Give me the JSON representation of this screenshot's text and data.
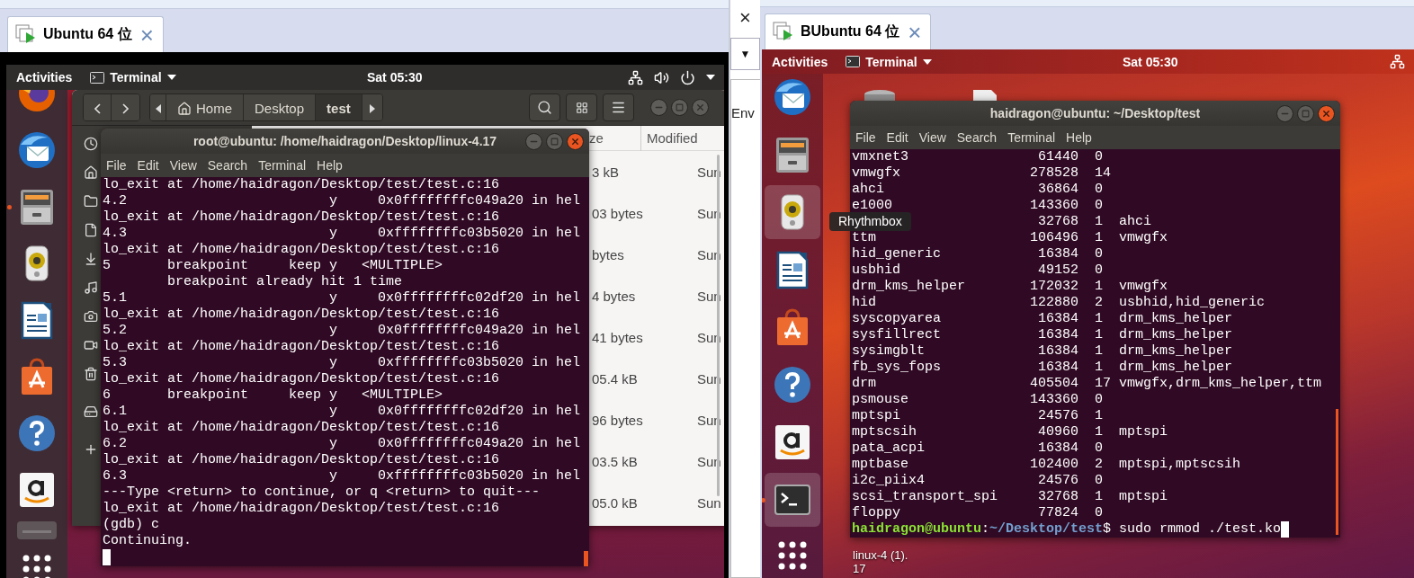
{
  "left_vm": {
    "tab": {
      "title": "Ubuntu 64 位",
      "close": "×"
    },
    "topbar": {
      "activities": "Activities",
      "app": "Terminal",
      "clock": "Sat 05:30"
    },
    "dock": [
      {
        "kind": "firefox",
        "running": false,
        "selected": false
      },
      {
        "kind": "thunderbird",
        "running": false,
        "selected": false
      },
      {
        "kind": "files",
        "running": true,
        "selected": false
      },
      {
        "kind": "rhythmbox",
        "running": false,
        "selected": false
      },
      {
        "kind": "writer",
        "running": false,
        "selected": false
      },
      {
        "kind": "software",
        "running": false,
        "selected": false
      },
      {
        "kind": "help",
        "running": false,
        "selected": false
      },
      {
        "kind": "amazon",
        "running": false,
        "selected": false
      },
      {
        "kind": "partial",
        "running": false,
        "selected": false
      },
      {
        "kind": "apps",
        "running": false,
        "selected": false
      }
    ],
    "file_manager": {
      "path": [
        {
          "label": "Home",
          "kind": "home",
          "selected": false
        },
        {
          "label": "Desktop",
          "kind": "plain",
          "selected": false
        },
        {
          "label": "test",
          "kind": "plain",
          "selected": true
        }
      ],
      "columns": [
        "ze",
        "Modified"
      ],
      "rows": [
        {
          "size": "3 kB",
          "modified": "Sun"
        },
        {
          "size": "03 bytes",
          "modified": "Sun"
        },
        {
          "size": "bytes",
          "modified": "Sun"
        },
        {
          "size": "4 bytes",
          "modified": "Sun"
        },
        {
          "size": "41 bytes",
          "modified": "Sun"
        },
        {
          "size": "05.4 kB",
          "modified": "Sun"
        },
        {
          "size": "96 bytes",
          "modified": "Sun"
        },
        {
          "size": "03.5 kB",
          "modified": "Sun"
        },
        {
          "size": "05.0 kB",
          "modified": "Sun"
        }
      ]
    },
    "terminal": {
      "title": "root@ubuntu: /home/haidragon/Desktop/linux-4.17",
      "menu": [
        "File",
        "Edit",
        "View",
        "Search",
        "Terminal",
        "Help"
      ],
      "lines": [
        "lo_exit at /home/haidragon/Desktop/test/test.c:16",
        "4.2                         y     0x0ffffffffc049a20 in hel",
        "lo_exit at /home/haidragon/Desktop/test/test.c:16",
        "4.3                         y     0xffffffffc03b5020 in hel",
        "lo_exit at /home/haidragon/Desktop/test/test.c:16",
        "5       breakpoint     keep y   <MULTIPLE>",
        "        breakpoint already hit 1 time",
        "5.1                         y     0x0ffffffffc02df20 in hel",
        "lo_exit at /home/haidragon/Desktop/test/test.c:16",
        "5.2                         y     0x0ffffffffc049a20 in hel",
        "lo_exit at /home/haidragon/Desktop/test/test.c:16",
        "5.3                         y     0xffffffffc03b5020 in hel",
        "lo_exit at /home/haidragon/Desktop/test/test.c:16",
        "6       breakpoint     keep y   <MULTIPLE>",
        "6.1                         y     0x0ffffffffc02df20 in hel",
        "lo_exit at /home/haidragon/Desktop/test/test.c:16",
        "6.2                         y     0x0ffffffffc049a20 in hel",
        "lo_exit at /home/haidragon/Desktop/test/test.c:16",
        "6.3                         y     0xffffffffc03b5020 in hel",
        "---Type <return> to continue, or q <return> to quit---",
        "lo_exit at /home/haidragon/Desktop/test/test.c:16",
        "(gdb) c",
        "Continuing."
      ]
    }
  },
  "right_vm": {
    "host_strip": {
      "close": "×",
      "dropdown": "▼",
      "text": "Env"
    },
    "tab": {
      "title": "BUbuntu 64 位",
      "close": "×"
    },
    "topbar": {
      "activities": "Activities",
      "app": "Terminal",
      "clock": "Sat 05:30"
    },
    "dock": [
      {
        "kind": "thunderbird",
        "running": false,
        "selected": false
      },
      {
        "kind": "files",
        "running": false,
        "selected": false
      },
      {
        "kind": "rhythmbox",
        "running": false,
        "selected": true
      },
      {
        "kind": "writer",
        "running": false,
        "selected": false
      },
      {
        "kind": "software",
        "running": false,
        "selected": false
      },
      {
        "kind": "help",
        "running": false,
        "selected": false
      },
      {
        "kind": "amazon",
        "running": false,
        "selected": false
      },
      {
        "kind": "terminal",
        "running": true,
        "selected": true
      },
      {
        "kind": "apps",
        "running": false,
        "selected": false
      }
    ],
    "terminal": {
      "title": "haidragon@ubuntu: ~/Desktop/test",
      "menu": [
        "File",
        "Edit",
        "View",
        "Search",
        "Terminal",
        "Help"
      ],
      "modules": [
        {
          "name": "vmxnet3",
          "size": "61440",
          "used": "0"
        },
        {
          "name": "vmwgfx",
          "size": "278528",
          "used": "14"
        },
        {
          "name": "ahci",
          "size": "36864",
          "used": "0"
        },
        {
          "name": "e1000",
          "size": "143360",
          "used": "0"
        },
        {
          "size": "32768",
          "used": "1",
          "by": "ahci"
        },
        {
          "name": "ttm",
          "size": "106496",
          "used": "1",
          "by": "vmwgfx"
        },
        {
          "name": "hid_generic",
          "size": "16384",
          "used": "0"
        },
        {
          "name": "usbhid",
          "size": "49152",
          "used": "0"
        },
        {
          "name": "drm_kms_helper",
          "size": "172032",
          "used": "1",
          "by": "vmwgfx"
        },
        {
          "name": "hid",
          "size": "122880",
          "used": "2",
          "by": "usbhid,hid_generic"
        },
        {
          "name": "syscopyarea",
          "size": "16384",
          "used": "1",
          "by": "drm_kms_helper"
        },
        {
          "name": "sysfillrect",
          "size": "16384",
          "used": "1",
          "by": "drm_kms_helper"
        },
        {
          "name": "sysimgblt",
          "size": "16384",
          "used": "1",
          "by": "drm_kms_helper"
        },
        {
          "name": "fb_sys_fops",
          "size": "16384",
          "used": "1",
          "by": "drm_kms_helper"
        },
        {
          "name": "drm",
          "size": "405504",
          "used": "17",
          "by": "vmwgfx,drm_kms_helper,ttm"
        },
        {
          "name": "psmouse",
          "size": "143360",
          "used": "0"
        },
        {
          "name": "mptspi",
          "size": "24576",
          "used": "1"
        },
        {
          "name": "mptscsih",
          "size": "40960",
          "used": "1",
          "by": "mptspi"
        },
        {
          "name": "pata_acpi",
          "size": "16384",
          "used": "0"
        },
        {
          "name": "mptbase",
          "size": "102400",
          "used": "2",
          "by": "mptspi,mptscsih"
        },
        {
          "name": "i2c_piix4",
          "size": "24576",
          "used": "0"
        },
        {
          "name": "scsi_transport_spi",
          "size": "32768",
          "used": "1",
          "by": "mptspi"
        },
        {
          "name": "floppy",
          "size": "77824",
          "used": "0"
        }
      ],
      "prompt": {
        "user": "haidragon@ubuntu",
        "sep": ":",
        "path": "~/Desktop/test",
        "command": "$ sudo rmmod ./test.ko"
      }
    },
    "tooltip": "Rhythmbox",
    "desktop_file": {
      "name_lines": [
        "linux-4 (1).",
        "17"
      ]
    }
  }
}
